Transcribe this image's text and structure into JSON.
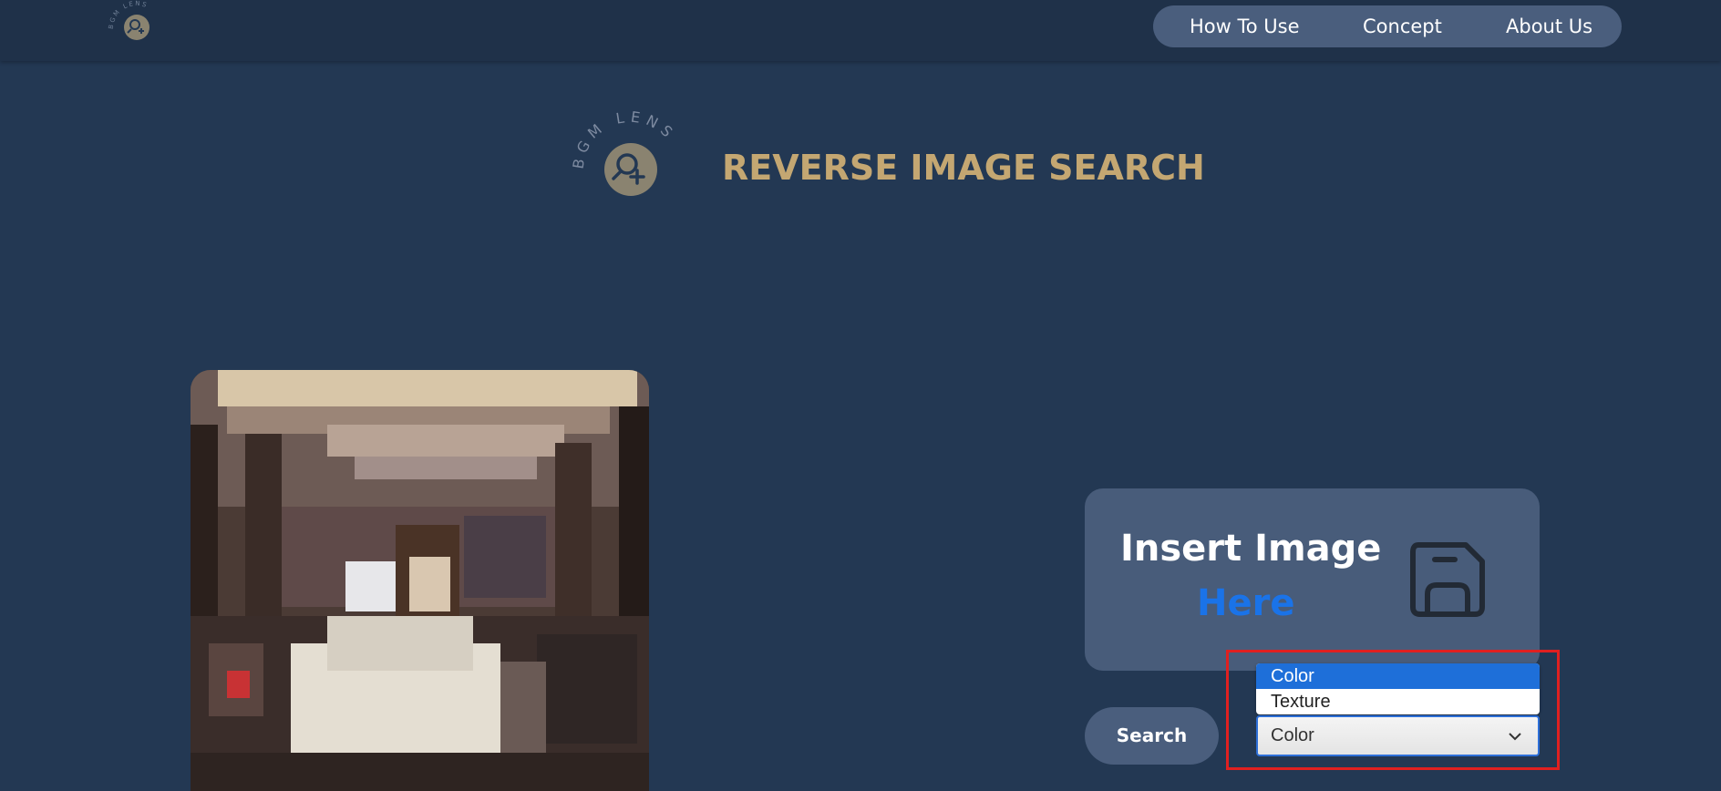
{
  "brand": {
    "logo_text": "BGM LENS",
    "page_title": "REVERSE IMAGE SEARCH"
  },
  "nav": {
    "items": [
      {
        "label": "How To Use"
      },
      {
        "label": "Concept"
      },
      {
        "label": "About Us"
      }
    ]
  },
  "upload": {
    "title": "Insert Image",
    "highlight": "Here",
    "icon": "save-icon"
  },
  "search": {
    "button_label": "Search",
    "feature_select": {
      "selected": "Color",
      "options": [
        "Color",
        "Texture"
      ]
    }
  },
  "colors": {
    "background": "#233853",
    "topbar": "#1f3149",
    "accent_gold": "#c4a772",
    "card": "#485c7a",
    "link_blue": "#1a73e8",
    "highlight_red": "#e02020"
  }
}
